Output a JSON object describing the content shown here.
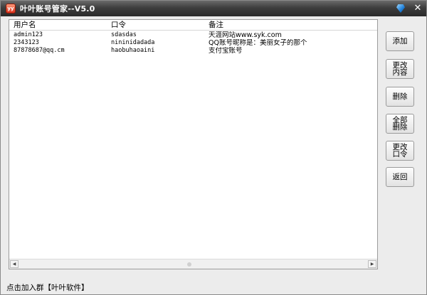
{
  "window": {
    "title": "叶叶账号管家--V5.0",
    "app_icon_text": "yy"
  },
  "list": {
    "columns": [
      "用户名",
      "口令",
      "备注"
    ],
    "rows": [
      {
        "username": "admin123",
        "password": "sdasdas",
        "note": "天涯网站www.syk.com"
      },
      {
        "username": "2343123",
        "password": "nininidadada",
        "note": "QQ账号昵称是：美丽女子的那个"
      },
      {
        "username": "87878687@qq.cm",
        "password": "haobuhaoaini",
        "note": "支付宝账号"
      }
    ]
  },
  "buttons": {
    "add": "添加",
    "edit_content": "更改内容",
    "delete": "删除",
    "delete_all": "全部删除",
    "change_password": "更改口令",
    "back": "返回"
  },
  "status": {
    "text": "点击加入群【叶叶软件】"
  },
  "colors": {
    "titlebar": "#3e3e3e",
    "skin_gem": "#1e7fd8"
  }
}
